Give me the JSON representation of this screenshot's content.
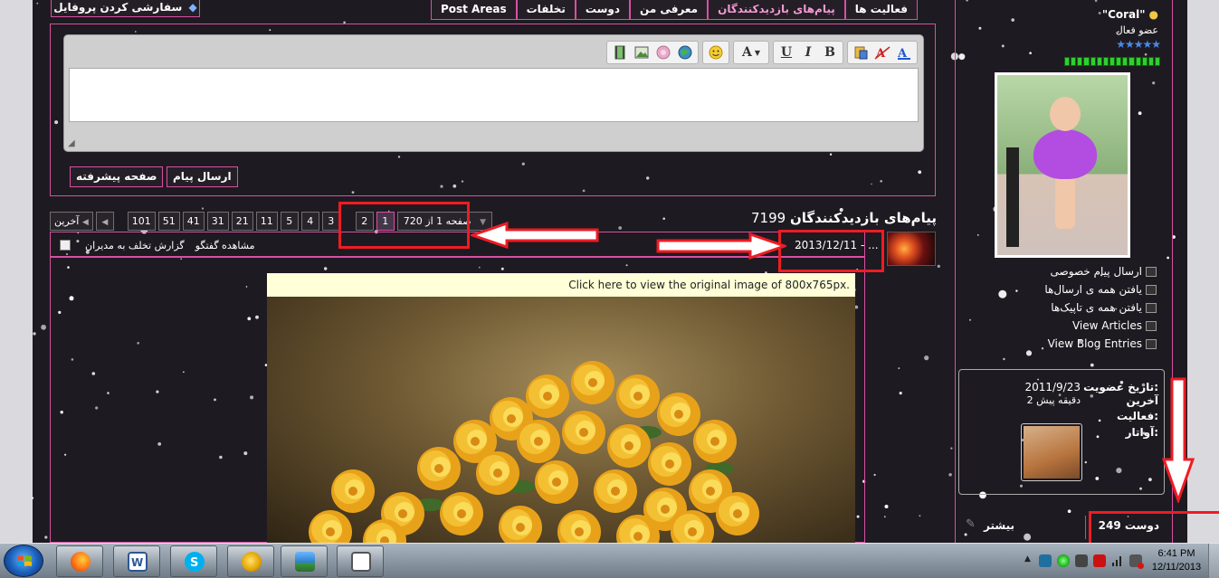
{
  "tabs": [
    {
      "label": "فعالیت ها",
      "active": false
    },
    {
      "label": "پیام‌های بازدیدکنندگان",
      "active": true
    },
    {
      "label": "معرفی من",
      "active": false
    },
    {
      "label": "دوست",
      "active": false
    },
    {
      "label": "تخلفات",
      "active": false
    },
    {
      "label": "Post Areas",
      "active": false
    }
  ],
  "profile_customize": {
    "label": "سفارشی کردن پروفایل",
    "icon": "diamond-icon"
  },
  "editor": {
    "toolbar_icons": [
      "font-color-icon",
      "font-size-icon",
      "paste-icon",
      "bold-icon",
      "italic-icon",
      "underline-icon",
      "font-icon",
      "smiley-icon",
      "globe-link-icon",
      "unlink-icon",
      "image-icon",
      "video-icon"
    ],
    "bold_glyph": "B",
    "italic_glyph": "I",
    "underline_glyph": "U",
    "font_glyph": "A",
    "submit_label": "ارسال پیام",
    "advanced_label": "صفحه پیشرفته"
  },
  "heading": {
    "count": "7199",
    "title": "پیام‌های بازدیدکنندگان"
  },
  "pager": {
    "page_select": "صفحه 1 از 720",
    "pages": [
      "1",
      "2",
      "3",
      "4",
      "5",
      "11",
      "21",
      "31",
      "41",
      "51",
      "101"
    ],
    "current": "1",
    "next_icon": "next-arrow-icon",
    "last_label": "آخرین"
  },
  "post": {
    "date": "2013/12/11 - ...",
    "view_conversation": "مشاهده گفتگو",
    "report": "گزارش تخلف به مدیران",
    "image_notice": "Click here to view the original image of 800x765px."
  },
  "profile": {
    "username": "\"Coral\"",
    "member_title": "عضو فعال",
    "links": [
      {
        "label": "ارسال پیام خصوصی",
        "icon": "mail-icon"
      },
      {
        "label": "یافتن همه ی ارسال‌ها",
        "icon": "posts-icon"
      },
      {
        "label": "یافتن همه ی تاپیک‌ها",
        "icon": "threads-icon"
      },
      {
        "label": "View Articles",
        "icon": "articles-icon"
      },
      {
        "label": "View Blog Entries",
        "icon": "blog-icon"
      }
    ],
    "about": {
      "join_label": "تاریخ عضویت:",
      "join_value": "2011/9/23",
      "last_label": "آخرین",
      "last_value": "2 دقیقه پیش",
      "activity_label": "فعالیت:",
      "avatar_label": "آواتار:"
    },
    "friends": "249 دوست",
    "more": "بیشتر"
  },
  "taskbar": {
    "time": "6:41 PM",
    "date": "12/11/2013",
    "apps": [
      "firefox-icon",
      "word-icon",
      "skype-icon",
      "messenger-icon",
      "photo-viewer-icon",
      "browser-window-icon"
    ]
  }
}
